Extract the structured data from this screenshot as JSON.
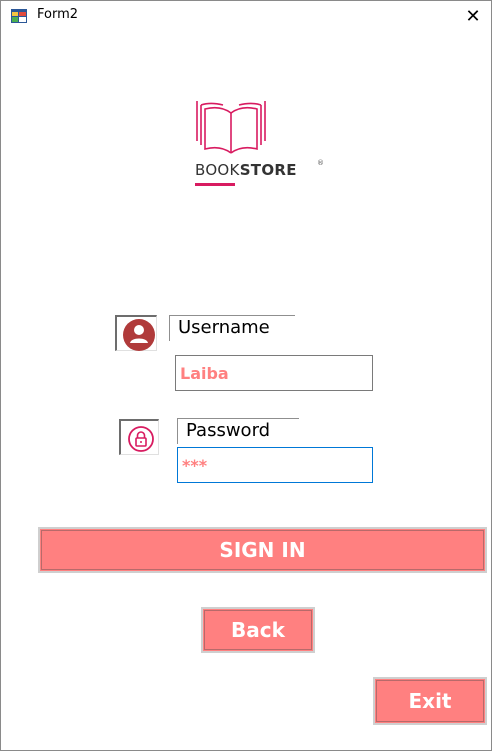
{
  "window": {
    "title": "Form2",
    "close_label": "✕"
  },
  "logo": {
    "text_regular": "BOOK",
    "text_bold": "STORE",
    "registered": "®"
  },
  "username": {
    "label": "Username",
    "value": "Laiba"
  },
  "password": {
    "label": "Password",
    "value": "***"
  },
  "buttons": {
    "sign_in": "SIGN IN",
    "back": "Back",
    "exit": "Exit"
  },
  "colors": {
    "accent": "#ff8080",
    "brand": "#d81b60",
    "focus_border": "#0078d7"
  }
}
